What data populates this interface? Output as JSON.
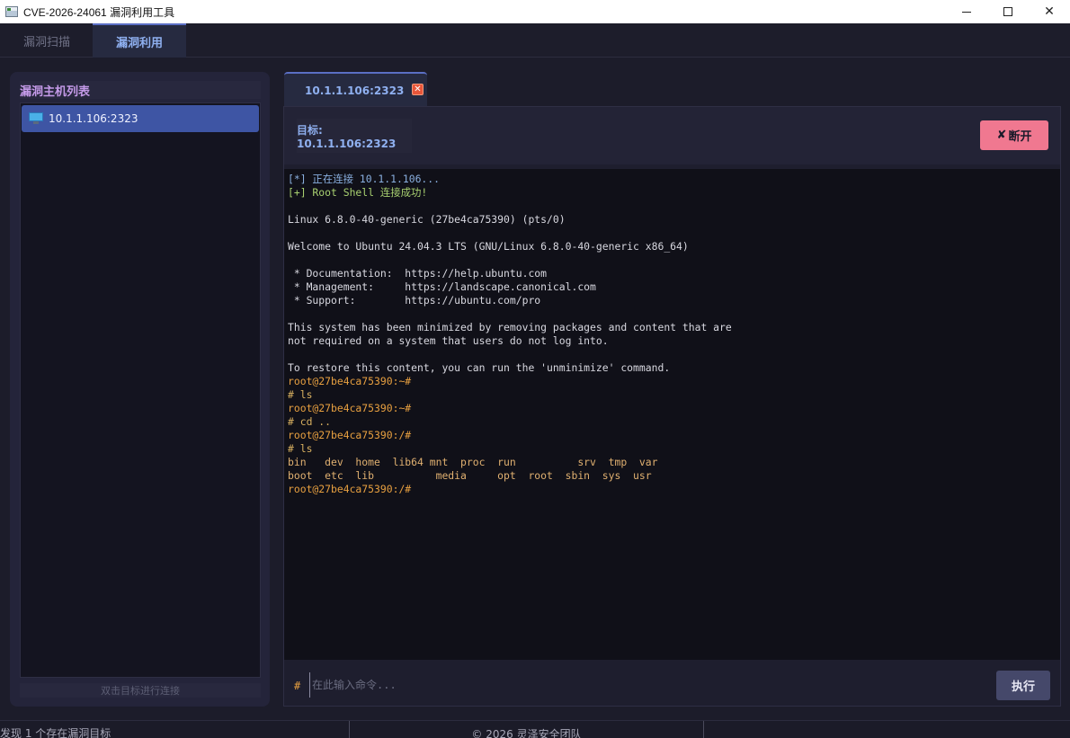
{
  "window": {
    "title": "CVE-2026-24061 漏洞利用工具",
    "minimize_icon": "minimize-icon",
    "maximize_icon": "maximize-icon",
    "close_symbol": "✕"
  },
  "main_tabs": [
    {
      "label": "漏洞扫描",
      "active": false
    },
    {
      "label": "漏洞利用",
      "active": true
    }
  ],
  "left_panel": {
    "header": "漏洞主机列表",
    "hosts": [
      {
        "label": "10.1.1.106:2323",
        "icon": "monitor-icon",
        "selected": true
      }
    ],
    "hint": "双击目标进行连接"
  },
  "session": {
    "tab_label": "10.1.1.106:2323",
    "tab_close": "✕",
    "target_label": "目标: 10.1.1.106:2323",
    "disconnect_icon": "✘",
    "disconnect_label": "断开",
    "terminal_lines": [
      {
        "t": "[*] 正在连接 10.1.1.106...",
        "c": "info"
      },
      {
        "t": "[+] Root Shell 连接成功!",
        "c": "ok"
      },
      {
        "t": "",
        "c": "w"
      },
      {
        "t": "Linux 6.8.0-40-generic (27be4ca75390) (pts/0)",
        "c": "w"
      },
      {
        "t": "",
        "c": "w"
      },
      {
        "t": "Welcome to Ubuntu 24.04.3 LTS (GNU/Linux 6.8.0-40-generic x86_64)",
        "c": "w"
      },
      {
        "t": "",
        "c": "w"
      },
      {
        "t": " * Documentation:  https://help.ubuntu.com",
        "c": "w"
      },
      {
        "t": " * Management:     https://landscape.canonical.com",
        "c": "w"
      },
      {
        "t": " * Support:        https://ubuntu.com/pro",
        "c": "w"
      },
      {
        "t": "",
        "c": "w"
      },
      {
        "t": "This system has been minimized by removing packages and content that are",
        "c": "w"
      },
      {
        "t": "not required on a system that users do not log into.",
        "c": "w"
      },
      {
        "t": "",
        "c": "w"
      },
      {
        "t": "To restore this content, you can run the 'unminimize' command.",
        "c": "w"
      },
      {
        "t": "root@27be4ca75390:~#",
        "c": "prompt"
      },
      {
        "t": "# ls",
        "c": "cmd"
      },
      {
        "t": "root@27be4ca75390:~#",
        "c": "prompt"
      },
      {
        "t": "# cd ..",
        "c": "cmd"
      },
      {
        "t": "root@27be4ca75390:/#",
        "c": "prompt"
      },
      {
        "t": "# ls",
        "c": "cmd"
      },
      {
        "t": "bin   dev  home  lib64 mnt  proc  run          srv  tmp  var",
        "c": "out"
      },
      {
        "t": "boot  etc  lib          media     opt  root  sbin  sys  usr",
        "c": "out"
      },
      {
        "t": "root@27be4ca75390:/#",
        "c": "prompt"
      }
    ],
    "prompt_symbol": "#",
    "input_placeholder": "在此输入命令...",
    "input_value": "",
    "execute_label": "执行"
  },
  "status_bar": {
    "left": "发现 1 个存在漏洞目标",
    "center": "© 2026 灵泽安全团队"
  }
}
